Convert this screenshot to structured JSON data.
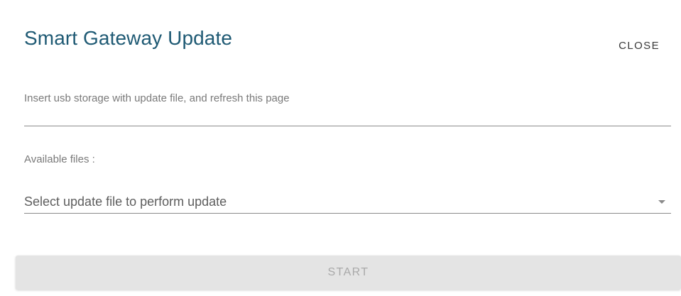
{
  "dialog": {
    "title": "Smart Gateway Update",
    "close_label": "CLOSE"
  },
  "usb": {
    "message": "Insert usb storage with update file, and refresh this page"
  },
  "files": {
    "label": "Available files :",
    "select_placeholder": "Select update file to perform update",
    "dropdown_icon": "caret-down-icon"
  },
  "actions": {
    "start_label": "START",
    "start_enabled": false
  },
  "colors": {
    "title": "#1f5a74",
    "start_bg_disabled": "#e4e4e4",
    "start_text_disabled": "#a9a9a9"
  }
}
